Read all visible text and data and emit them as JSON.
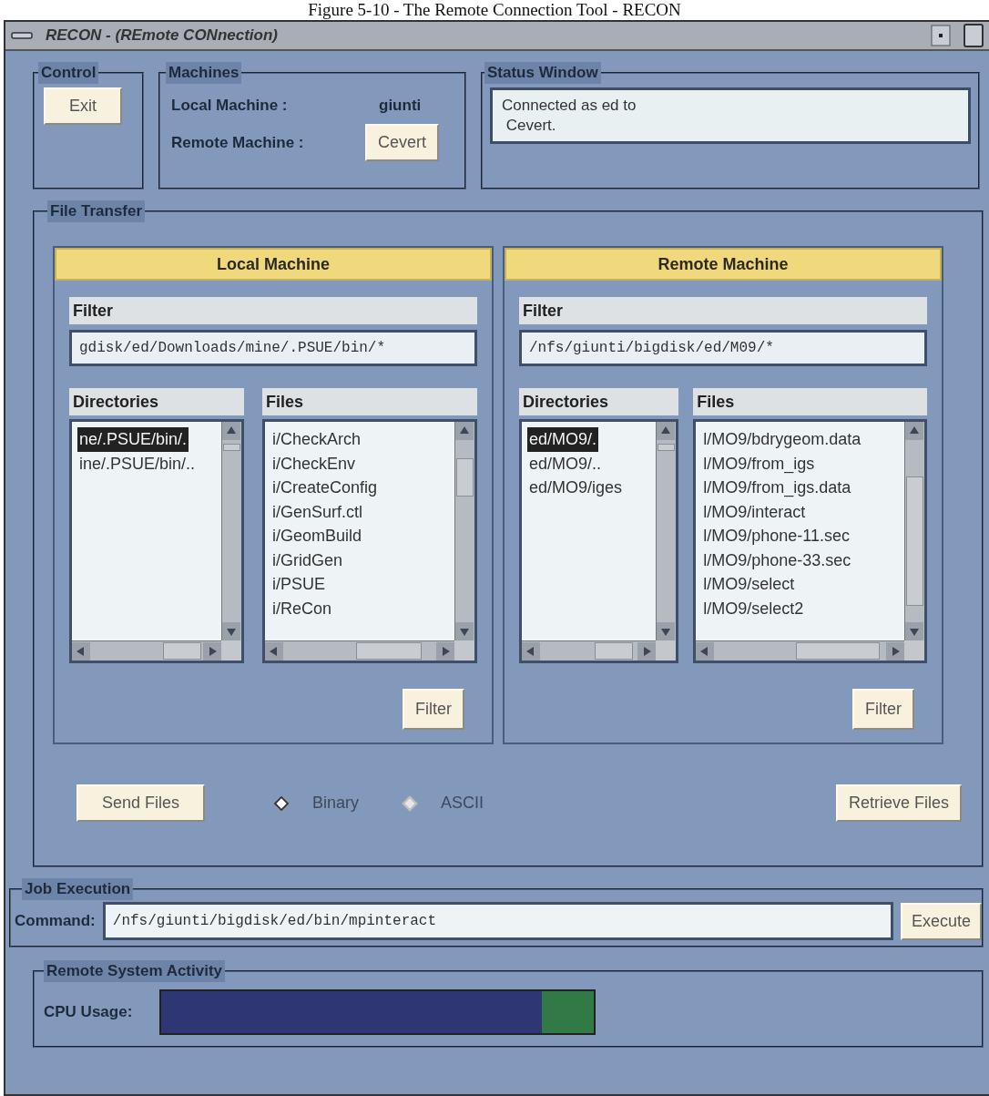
{
  "caption": "Figure 5-10 - The Remote Connection Tool - RECON",
  "window": {
    "title": "RECON - (REmote CONnection)"
  },
  "control": {
    "title": "Control",
    "button": "Exit"
  },
  "machines": {
    "title": "Machines",
    "local_label": "Local Machine :",
    "local_value": "giunti",
    "remote_label": "Remote Machine :",
    "remote_button": "Cevert"
  },
  "status_window": {
    "title": "Status Window",
    "lines": [
      "Connected as ed to",
      " Cevert."
    ]
  },
  "file_transfer": {
    "title": "File Transfer",
    "panels": [
      {
        "header": "Local Machine",
        "filter_label": "Filter",
        "filter_value": "gdisk/ed/Downloads/mine/.PSUE/bin/*",
        "directories_label": "Directories",
        "directories": [
          {
            "name": "ne/.PSUE/bin/.",
            "selected": true
          },
          {
            "name": "ine/.PSUE/bin/..",
            "selected": false
          }
        ],
        "files_label": "Files",
        "files": [
          {
            "name": "i/CheckArch",
            "selected": false
          },
          {
            "name": "i/CheckEnv",
            "selected": false
          },
          {
            "name": "i/CreateConfig",
            "selected": false
          },
          {
            "name": "i/GenSurf.ctl",
            "selected": false
          },
          {
            "name": "i/GeomBuild",
            "selected": false
          },
          {
            "name": "i/GridGen",
            "selected": false
          },
          {
            "name": "i/PSUE",
            "selected": false
          },
          {
            "name": "i/ReCon",
            "selected": false
          }
        ],
        "filter_button": "Filter"
      },
      {
        "header": "Remote Machine",
        "filter_label": "Filter",
        "filter_value": "/nfs/giunti/bigdisk/ed/M09/*",
        "directories_label": "Directories",
        "directories": [
          {
            "name": "ed/MO9/.",
            "selected": true
          },
          {
            "name": "ed/MO9/..",
            "selected": false
          },
          {
            "name": "ed/MO9/iges",
            "selected": false
          }
        ],
        "files_label": "Files",
        "files": [
          {
            "name": "l/MO9/bdrygeom.data",
            "selected": false
          },
          {
            "name": "l/MO9/from_igs",
            "selected": false
          },
          {
            "name": "l/MO9/from_igs.data",
            "selected": false
          },
          {
            "name": "l/MO9/interact",
            "selected": false
          },
          {
            "name": "l/MO9/phone-11.sec",
            "selected": false
          },
          {
            "name": "l/MO9/phone-33.sec",
            "selected": false
          },
          {
            "name": "l/MO9/select",
            "selected": false
          },
          {
            "name": "l/MO9/select2",
            "selected": false
          }
        ],
        "filter_button": "Filter"
      }
    ],
    "send_button": "Send Files",
    "modes": [
      {
        "label": "Binary",
        "selected": true,
        "disabled": true
      },
      {
        "label": "ASCII",
        "selected": false,
        "disabled": true
      }
    ],
    "retrieve_button": "Retrieve Files"
  },
  "job_execution": {
    "title": "Job Execution",
    "command_label": "Command:",
    "command_value": "/nfs/giunti/bigdisk/ed/bin/mpinteract",
    "execute_button": "Execute"
  },
  "remote_activity": {
    "title": "Remote System Activity",
    "cpu_label": "CPU Usage:",
    "level": 0.88
  }
}
